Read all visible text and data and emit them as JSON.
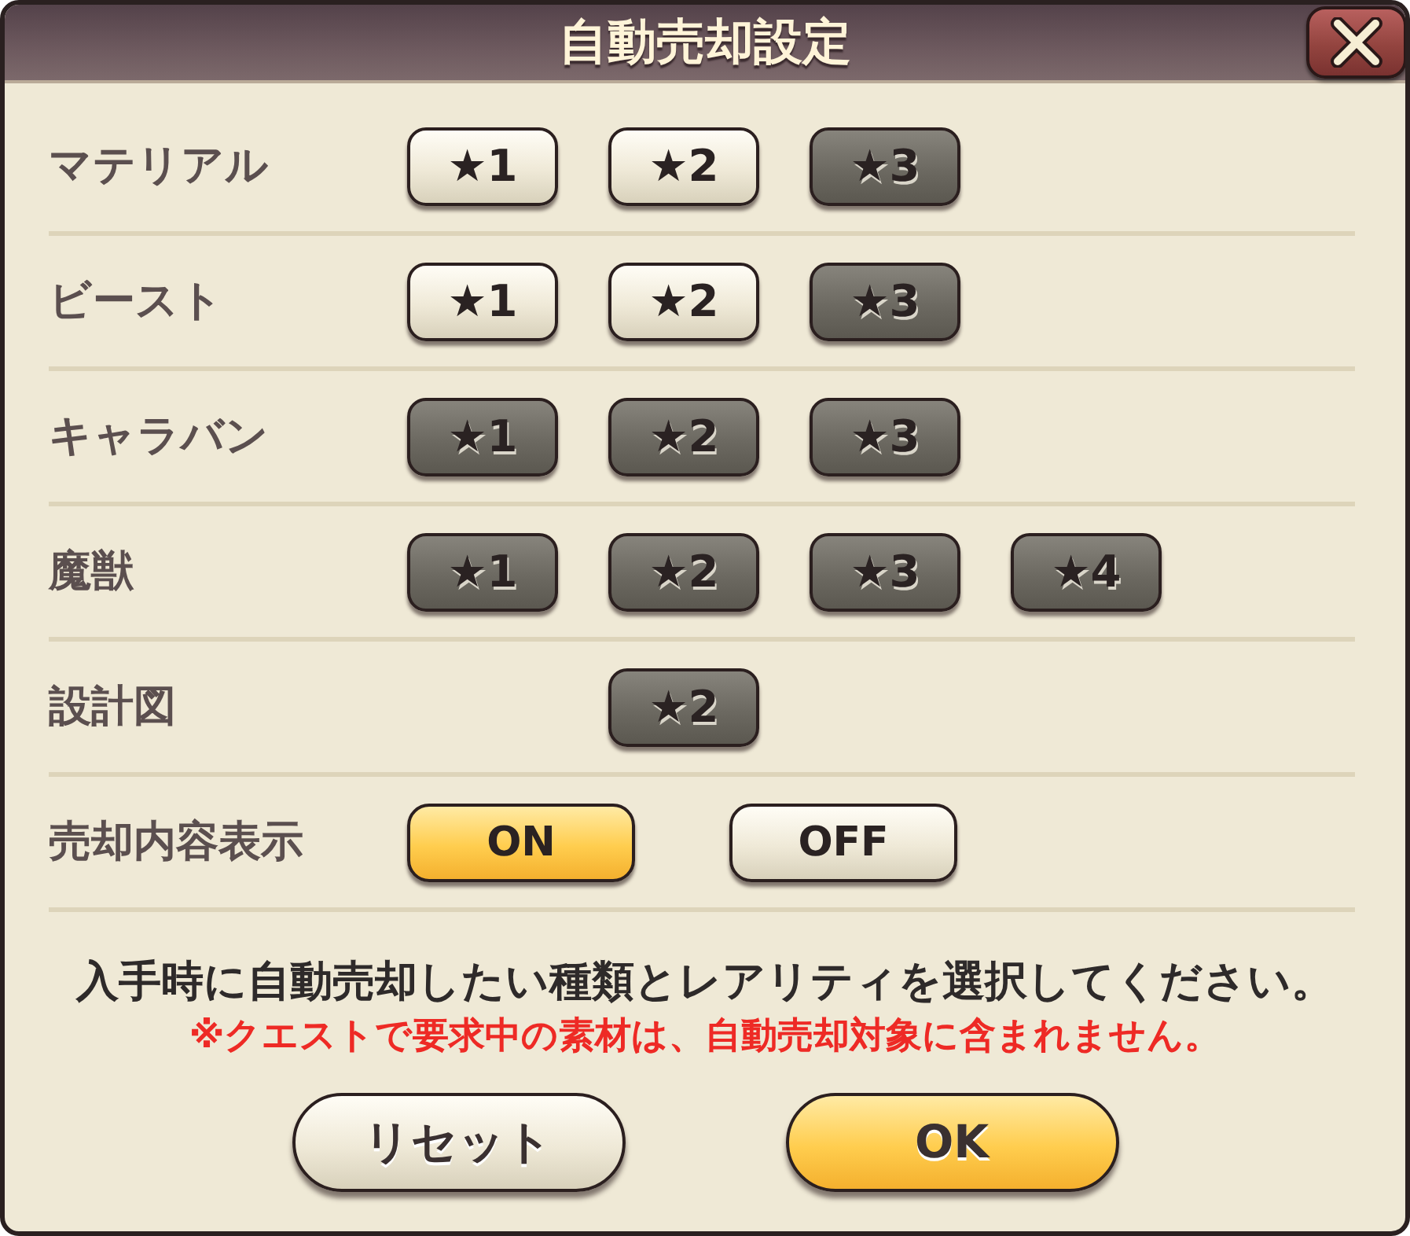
{
  "dialog": {
    "title": "自動売却設定"
  },
  "rows": [
    {
      "kind": "rarity",
      "label": "マテリアル",
      "buttons": [
        {
          "label": "★1",
          "selected": false
        },
        {
          "label": "★2",
          "selected": false
        },
        {
          "label": "★3",
          "selected": true
        }
      ]
    },
    {
      "kind": "rarity",
      "label": "ビースト",
      "buttons": [
        {
          "label": "★1",
          "selected": false
        },
        {
          "label": "★2",
          "selected": false
        },
        {
          "label": "★3",
          "selected": true
        }
      ]
    },
    {
      "kind": "rarity",
      "label": "キャラバン",
      "buttons": [
        {
          "label": "★1",
          "selected": true
        },
        {
          "label": "★2",
          "selected": true
        },
        {
          "label": "★3",
          "selected": true
        }
      ]
    },
    {
      "kind": "rarity",
      "label": "魔獣",
      "buttons": [
        {
          "label": "★1",
          "selected": true
        },
        {
          "label": "★2",
          "selected": true
        },
        {
          "label": "★3",
          "selected": true
        },
        {
          "label": "★4",
          "selected": true
        }
      ]
    },
    {
      "kind": "rarity",
      "label": "設計図",
      "leading_gap": true,
      "buttons": [
        {
          "label": "★2",
          "selected": true
        }
      ]
    },
    {
      "kind": "toggle",
      "label": "売却内容表示",
      "options": [
        {
          "label": "ON",
          "selected": true
        },
        {
          "label": "OFF",
          "selected": false
        }
      ]
    }
  ],
  "instruction": "入手時に自動売却したい種類とレアリティを選択してください。",
  "warning": "※クエストで要求中の素材は、自動売却対象に含まれません。",
  "buttons": [
    {
      "label": "リセット",
      "kind": "secondary"
    },
    {
      "label": "OK",
      "kind": "primary"
    }
  ]
}
